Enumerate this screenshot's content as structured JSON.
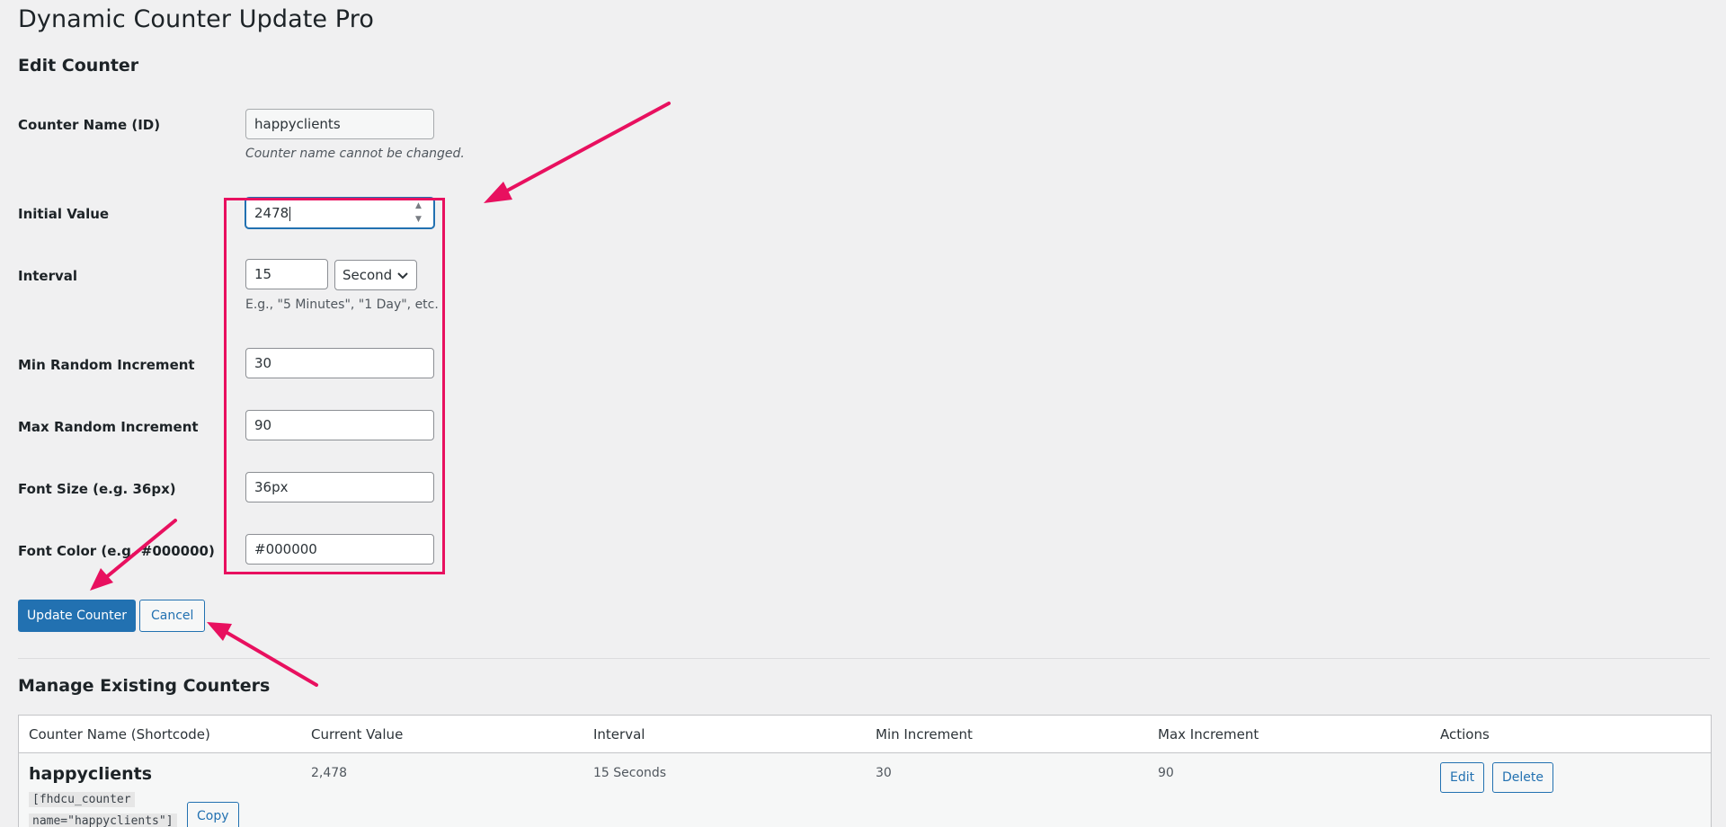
{
  "page": {
    "title": "Dynamic Counter Update Pro",
    "section_title": "Edit Counter"
  },
  "form": {
    "counter_name": {
      "label": "Counter Name (ID)",
      "value": "happyclients",
      "description": "Counter name cannot be changed."
    },
    "initial_value": {
      "label": "Initial Value",
      "value": "2478"
    },
    "interval": {
      "label": "Interval",
      "value": "15",
      "unit": "Second",
      "description": "E.g., \"5 Minutes\", \"1 Day\", etc."
    },
    "min_increment": {
      "label": "Min Random Increment",
      "value": "30"
    },
    "max_increment": {
      "label": "Max Random Increment",
      "value": "90"
    },
    "font_size": {
      "label": "Font Size (e.g. 36px)",
      "value": "36px"
    },
    "font_color": {
      "label": "Font Color (e.g. #000000)",
      "value": "#000000"
    },
    "buttons": {
      "update": "Update Counter",
      "cancel": "Cancel"
    }
  },
  "manage": {
    "title": "Manage Existing Counters",
    "columns": [
      "Counter Name (Shortcode)",
      "Current Value",
      "Interval",
      "Min Increment",
      "Max Increment",
      "Actions"
    ],
    "rows": [
      {
        "name": "happyclients",
        "shortcode_line1": "[fhdcu_counter",
        "shortcode_line2": "name=\"happyclients\"]",
        "copy_label": "Copy",
        "current_value": "2,478",
        "interval": "15 Seconds",
        "min_increment": "30",
        "max_increment": "90",
        "edit_label": "Edit",
        "delete_label": "Delete"
      }
    ]
  },
  "colors": {
    "accent": "#2271b1",
    "annotation": "#e8105f",
    "background": "#f0f0f1"
  },
  "icons": {
    "spinner": "number-spinner-icon",
    "select": "chevron-down-icon",
    "annotation": "arrow-annotation-icon"
  }
}
